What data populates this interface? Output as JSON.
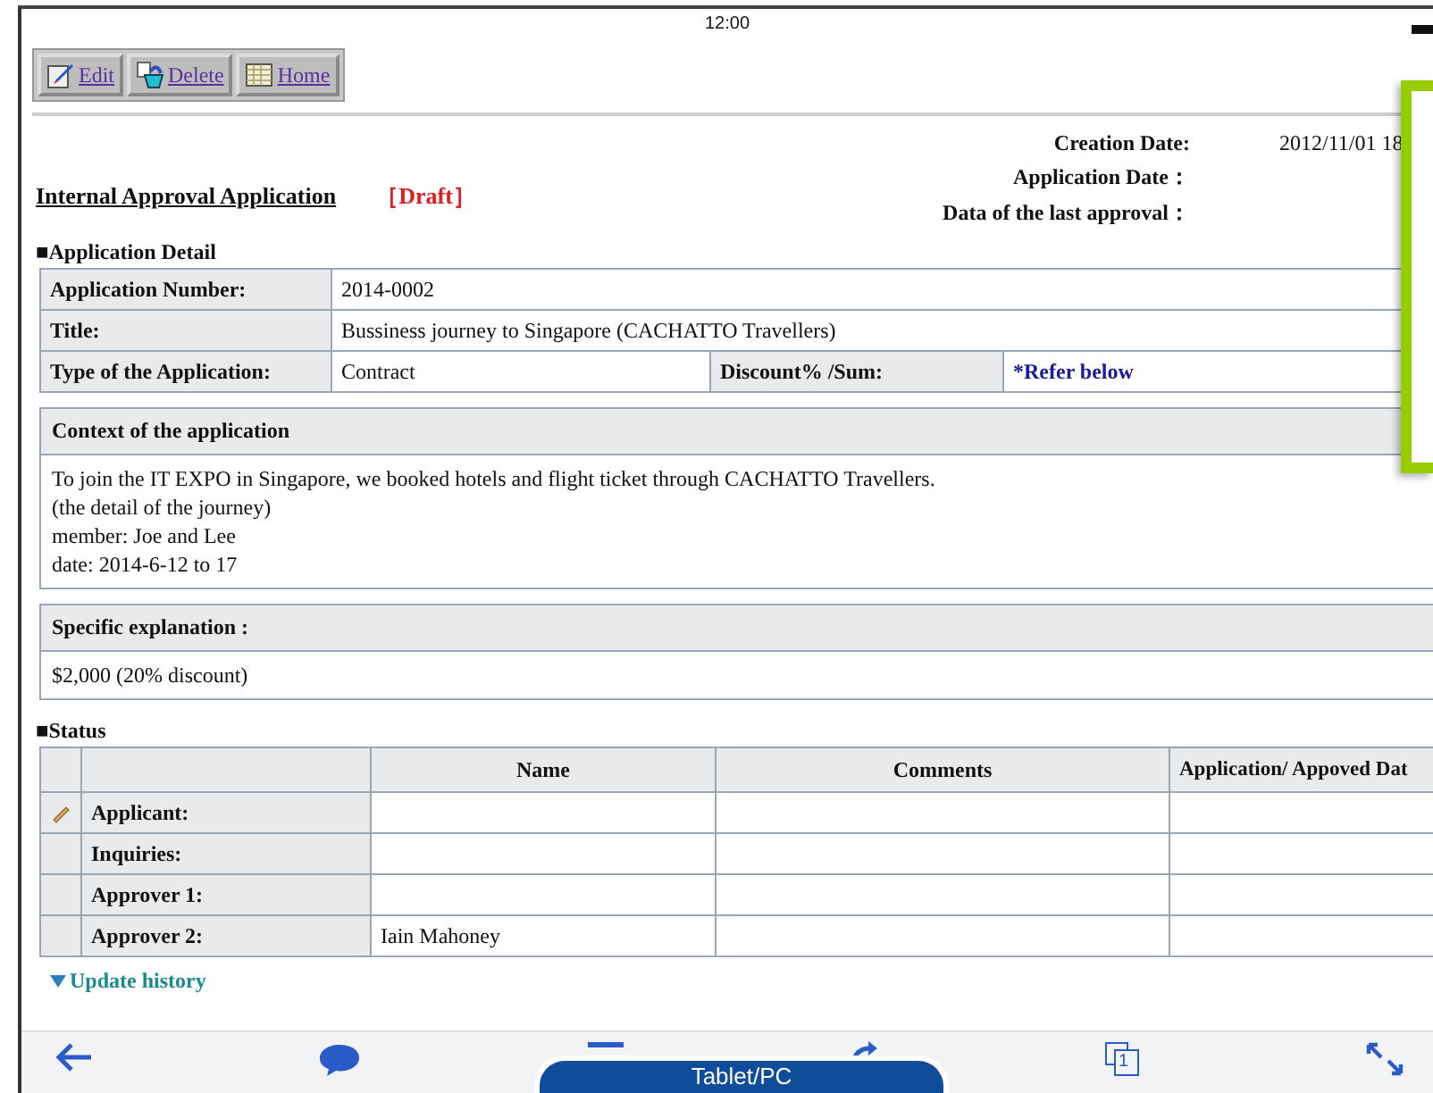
{
  "status_bar": {
    "time": "12:00"
  },
  "toolbar": [
    {
      "kind": "edit",
      "label": "Edit"
    },
    {
      "kind": "delete",
      "label": "Delete"
    },
    {
      "kind": "home",
      "label": "Home"
    }
  ],
  "form": {
    "title": "Internal Approval Application",
    "badge": "［Draft］",
    "dates": [
      {
        "label": "Creation Date:",
        "value": "2012/11/01 18"
      },
      {
        "label": "Application Date："
      },
      {
        "label": "Data of the last approval："
      }
    ]
  },
  "detail": {
    "heading": "■Application Detail",
    "rows": [
      {
        "cells": [
          {
            "kind": "label",
            "text": "Application Number:"
          },
          {
            "kind": "text",
            "text": "2014-0002",
            "colspan": 3
          }
        ]
      },
      {
        "cells": [
          {
            "kind": "label",
            "text": "Title:"
          },
          {
            "kind": "text",
            "text": "Bussiness journey to Singapore (CACHATTO Travellers)",
            "colspan": 3
          }
        ]
      },
      {
        "cells": [
          {
            "kind": "label",
            "text": "Type of the Application:"
          },
          {
            "kind": "text",
            "text": "Contract"
          },
          {
            "kind": "label",
            "text": "Discount% /Sum:"
          },
          {
            "kind": "note",
            "text": "*Refer below"
          }
        ]
      }
    ]
  },
  "sections": [
    {
      "heading": "Context of the application",
      "lines": [
        "To join the IT EXPO in Singapore, we booked hotels and flight ticket through CACHATTO Travellers.",
        "(the detail of the journey)",
        "member: Joe and Lee",
        "date: 2014-6-12 to 17"
      ]
    },
    {
      "heading": "Specific explanation :",
      "lines": [
        "$2,000 (20% discount)"
      ]
    }
  ],
  "status": {
    "heading": "■Status",
    "columns": [
      "Name",
      "Comments",
      "Application/ Appoved Dat"
    ],
    "rows": [
      {
        "label": "Applicant:",
        "current": true
      },
      {
        "label": "Inquiries:",
        "current": false
      },
      {
        "label": "Approver 1:",
        "current": false
      },
      {
        "label": "Approver 2:",
        "current": false,
        "name": "Iain Mahoney"
      }
    ]
  },
  "update_history": {
    "label": "Update history"
  },
  "bottom_bar": {
    "page_count": "1",
    "mode": "Tablet/PC"
  }
}
